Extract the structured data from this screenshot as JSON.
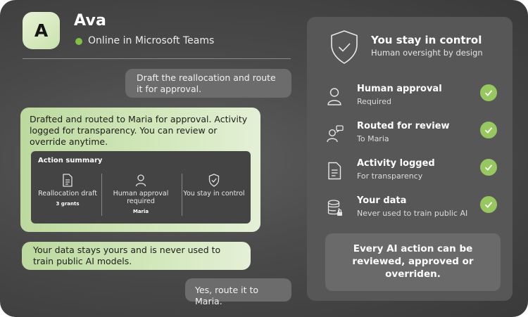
{
  "agent": {
    "initial": "A",
    "name": "Ava",
    "status": "Online in Microsoft Teams",
    "status_color": "#7fc241"
  },
  "chat": {
    "user_message_1": "Draft the reallocation and route it for approval.",
    "ai_message_1": "Drafted and routed to Maria for approval. Activity logged for transparency. You can review or override anytime.",
    "summary": {
      "title": "Action summary",
      "items": [
        {
          "label": "Reallocation draft",
          "sub": "3 grants",
          "icon": "document-icon"
        },
        {
          "label": "Human approval required",
          "sub": "Maria",
          "icon": "person-icon"
        },
        {
          "label": "You stay in control",
          "sub": "",
          "icon": "shield-check-icon"
        }
      ]
    },
    "ai_message_2": "Your data stays yours and is never used to train public AI models.",
    "user_message_2": "Yes, route it to Maria."
  },
  "panel": {
    "title": "You stay in control",
    "subtitle": "Human oversight by design",
    "features": [
      {
        "title": "Human approval",
        "sub": "Required",
        "icon": "person-icon"
      },
      {
        "title": "Routed for review",
        "sub": "To Maria",
        "icon": "person-chat-icon"
      },
      {
        "title": "Activity logged",
        "sub": "For transparency",
        "icon": "document-icon"
      },
      {
        "title": "Your data",
        "sub": "Never used to train public AI",
        "icon": "database-lock-icon"
      }
    ],
    "callout": "Every AI action can be reviewed, approved or overriden.",
    "check_color": "#96c85f"
  }
}
